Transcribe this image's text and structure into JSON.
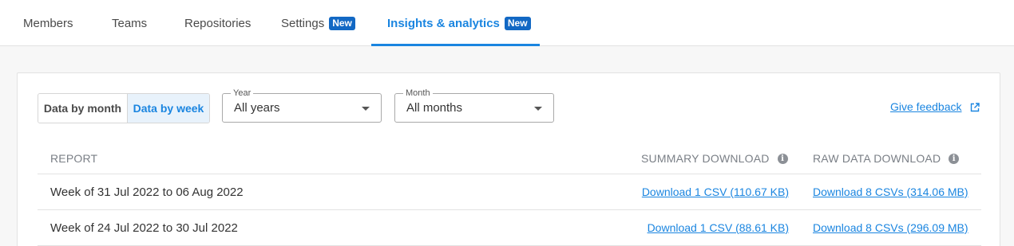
{
  "tabs": [
    {
      "label": "Members"
    },
    {
      "label": "Teams"
    },
    {
      "label": "Repositories"
    },
    {
      "label": "Settings",
      "badge": "New"
    },
    {
      "label": "Insights & analytics",
      "badge": "New",
      "active": true
    }
  ],
  "toggle": {
    "month_label": "Data by month",
    "week_label": "Data by week",
    "selected": "week"
  },
  "filters": {
    "year": {
      "label": "Year",
      "value": "All years"
    },
    "month": {
      "label": "Month",
      "value": "All months"
    }
  },
  "feedback": {
    "label": "Give feedback",
    "icon": "external-link-icon"
  },
  "table": {
    "headers": {
      "report": "REPORT",
      "summary": "SUMMARY DOWNLOAD",
      "raw": "RAW DATA DOWNLOAD"
    },
    "rows": [
      {
        "report": "Week of 31 Jul 2022 to 06 Aug 2022",
        "summary": "Download 1 CSV (110.67 KB)",
        "raw": "Download 8 CSVs (314.06 MB)"
      },
      {
        "report": "Week of 24 Jul 2022 to 30 Jul 2022",
        "summary": "Download 1 CSV (88.61 KB)",
        "raw": "Download 8 CSVs (296.09 MB)"
      }
    ]
  },
  "colors": {
    "accent": "#1a85e0",
    "badge": "#1268c4",
    "border": "#e2e2e2",
    "header_text": "#7a7f86"
  }
}
